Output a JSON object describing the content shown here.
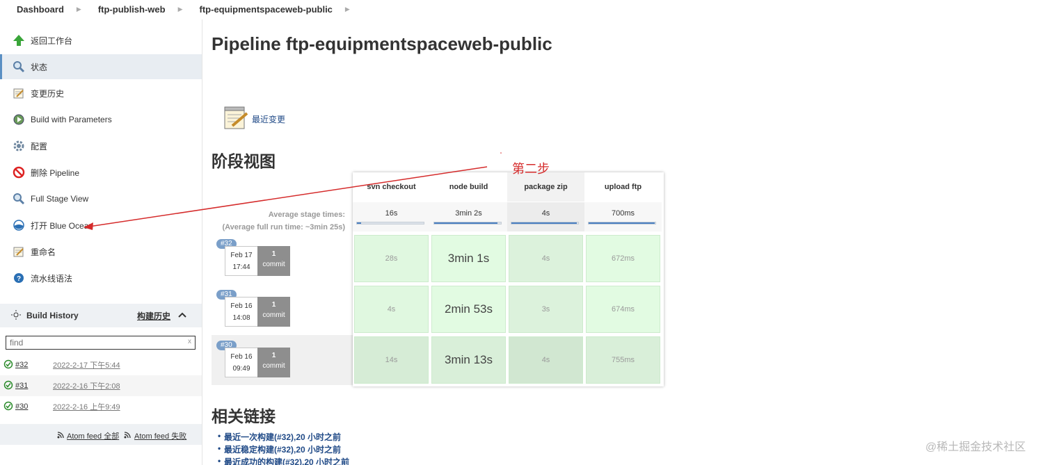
{
  "breadcrumb": [
    "Dashboard",
    "ftp-publish-web",
    "ftp-equipmentspaceweb-public"
  ],
  "sidebar": {
    "tasks": [
      {
        "label": "返回工作台",
        "icon": "up-arrow-icon"
      },
      {
        "label": "状态",
        "icon": "search-icon"
      },
      {
        "label": "变更历史",
        "icon": "notepad-icon"
      },
      {
        "label": "Build with Parameters",
        "icon": "build-icon"
      },
      {
        "label": "配置",
        "icon": "gear-icon"
      },
      {
        "label": "删除 Pipeline",
        "icon": "delete-icon"
      },
      {
        "label": "Full Stage View",
        "icon": "search-icon"
      },
      {
        "label": "打开 Blue Ocean",
        "icon": "blue-ocean-icon"
      },
      {
        "label": "重命名",
        "icon": "notepad-icon"
      },
      {
        "label": "流水线语法",
        "icon": "help-icon"
      }
    ],
    "build_history": {
      "title": "Build History",
      "trend": "构建历史",
      "find_placeholder": "find",
      "find_clear": "x",
      "builds": [
        {
          "number": "#32",
          "time": "2022-2-17 下午5:44"
        },
        {
          "number": "#31",
          "time": "2022-2-16 下午2:08"
        },
        {
          "number": "#30",
          "time": "2022-2-16 上午9:49"
        }
      ],
      "atom_all": "Atom feed 全部",
      "atom_failed": "Atom feed 失败"
    }
  },
  "main": {
    "title": "Pipeline ftp-equipmentspaceweb-public",
    "recent_changes": "最近变更",
    "stage_view_heading": "阶段视图",
    "avg_stage_label": "Average stage times:",
    "avg_full_label": "(Average full run time: ~3min 25s)",
    "stages": [
      "svn checkout",
      "node build",
      "package zip",
      "upload ftp"
    ],
    "avg_times": [
      "16s",
      "3min 2s",
      "4s",
      "700ms"
    ],
    "avg_progress": [
      0.06,
      0.95,
      0.98,
      0.99
    ],
    "runs": [
      {
        "badge": "#32",
        "date": "Feb 17",
        "time": "17:44",
        "commits": "1",
        "commit_label": "commit",
        "durations": [
          "28s",
          "3min 1s",
          "4s",
          "672ms"
        ]
      },
      {
        "badge": "#31",
        "date": "Feb 16",
        "time": "14:08",
        "commits": "1",
        "commit_label": "commit",
        "durations": [
          "4s",
          "2min 53s",
          "3s",
          "674ms"
        ]
      },
      {
        "badge": "#30",
        "date": "Feb 16",
        "time": "09:49",
        "commits": "1",
        "commit_label": "commit",
        "durations": [
          "14s",
          "3min 13s",
          "4s",
          "755ms"
        ]
      }
    ],
    "related_heading": "相关链接",
    "links": [
      "最近一次构建(#32),20 小时之前",
      "最近稳定构建(#32),20 小时之前",
      "最近成功的构建(#32),20 小时之前"
    ]
  },
  "annotation": "第二步",
  "watermark": "@稀土掘金技术社区",
  "colors": {
    "success_green": "#e3fbe3",
    "annotation_red": "#d52b2b",
    "link_blue": "#204a87"
  }
}
